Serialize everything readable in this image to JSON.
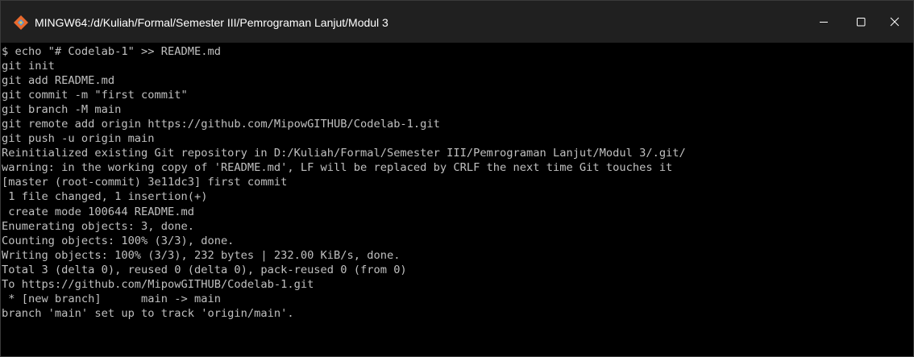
{
  "window": {
    "title": "MINGW64:/d/Kuliah/Formal/Semester III/Pemrograman Lanjut/Modul 3",
    "icons": [
      "git-diamond-icon",
      "minimize-icon",
      "maximize-icon",
      "close-icon"
    ]
  },
  "colors": {
    "titlebar": "#202020",
    "terminal_bg": "#000000",
    "terminal_text": "#c0c0c0",
    "icon_orange": "#e8692d",
    "icon_blue": "#4d9de0"
  },
  "terminal": {
    "lines": [
      "$ echo \"# Codelab-1\" >> README.md",
      "git init",
      "git add README.md",
      "git commit -m \"first commit\"",
      "git branch -M main",
      "git remote add origin https://github.com/MipowGITHUB/Codelab-1.git",
      "git push -u origin main",
      "Reinitialized existing Git repository in D:/Kuliah/Formal/Semester III/Pemrograman Lanjut/Modul 3/.git/",
      "warning: in the working copy of 'README.md', LF will be replaced by CRLF the next time Git touches it",
      "[master (root-commit) 3e11dc3] first commit",
      " 1 file changed, 1 insertion(+)",
      " create mode 100644 README.md",
      "Enumerating objects: 3, done.",
      "Counting objects: 100% (3/3), done.",
      "Writing objects: 100% (3/3), 232 bytes | 232.00 KiB/s, done.",
      "Total 3 (delta 0), reused 0 (delta 0), pack-reused 0 (from 0)",
      "To https://github.com/MipowGITHUB/Codelab-1.git",
      " * [new branch]      main -> main",
      "branch 'main' set up to track 'origin/main'."
    ]
  }
}
